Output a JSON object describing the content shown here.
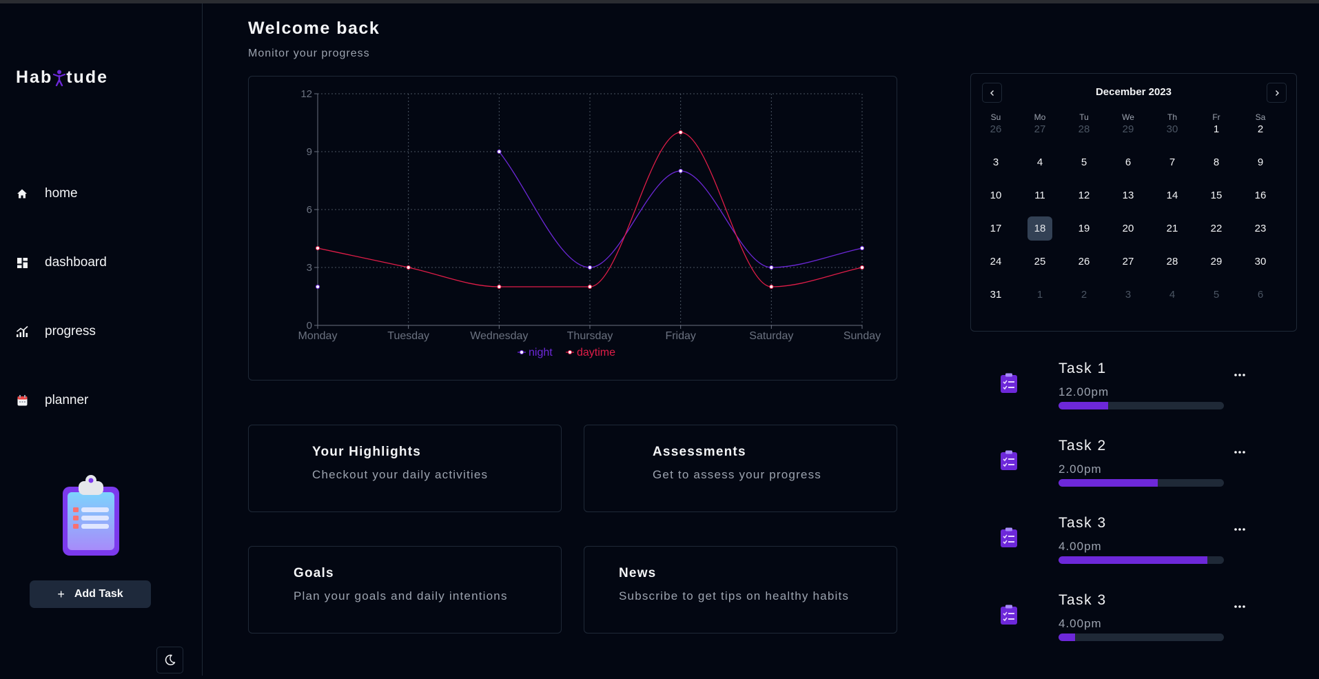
{
  "app": {
    "logo_left": "Hab",
    "logo_right": "tude"
  },
  "sidebar": {
    "items": [
      {
        "label": "home",
        "icon": "home-icon"
      },
      {
        "label": "dashboard",
        "icon": "dashboard-icon"
      },
      {
        "label": "progress",
        "icon": "progress-icon"
      },
      {
        "label": "planner",
        "icon": "planner-icon"
      }
    ],
    "add_task_label": "Add Task",
    "add_task_icon": "plus-icon",
    "theme_toggle_icon": "moon-icon",
    "illustration": "clipboard-illustration"
  },
  "header": {
    "title": "Welcome back",
    "subtitle": "Monitor your progress"
  },
  "chart_data": {
    "type": "line",
    "categories": [
      "Monday",
      "Tuesday",
      "Wednesday",
      "Thursday",
      "Friday",
      "Saturday",
      "Sunday"
    ],
    "ylim": [
      0,
      12
    ],
    "yticks": [
      "0",
      "3",
      "6",
      "9",
      "12"
    ],
    "grid": true,
    "legend_position": "bottom-center",
    "series": [
      {
        "name": "night",
        "color": "#6d28d9",
        "values": [
          2,
          null,
          9,
          3,
          8,
          3,
          4
        ]
      },
      {
        "name": "daytime",
        "color": "#e11d48",
        "values": [
          4,
          3,
          2,
          2,
          10,
          2,
          3
        ]
      }
    ]
  },
  "cards": [
    {
      "title": "Your Highlights",
      "desc": "Checkout your daily activities"
    },
    {
      "title": "Assessments",
      "desc": "Get to assess your progress"
    },
    {
      "title": "Goals",
      "desc": "Plan your goals and daily intentions"
    },
    {
      "title": "News",
      "desc": "Subscribe to get tips on healthy habits"
    }
  ],
  "calendar": {
    "title": "December 2023",
    "weekdays": [
      "Su",
      "Mo",
      "Tu",
      "We",
      "Th",
      "Fr",
      "Sa"
    ],
    "selected_day": "18",
    "weeks": [
      [
        {
          "d": "26",
          "m": true
        },
        {
          "d": "27",
          "m": true
        },
        {
          "d": "28",
          "m": true
        },
        {
          "d": "29",
          "m": true
        },
        {
          "d": "30",
          "m": true
        },
        {
          "d": "1"
        },
        {
          "d": "2"
        }
      ],
      [
        {
          "d": "3"
        },
        {
          "d": "4"
        },
        {
          "d": "5"
        },
        {
          "d": "6"
        },
        {
          "d": "7"
        },
        {
          "d": "8"
        },
        {
          "d": "9"
        }
      ],
      [
        {
          "d": "10"
        },
        {
          "d": "11"
        },
        {
          "d": "12"
        },
        {
          "d": "13"
        },
        {
          "d": "14"
        },
        {
          "d": "15"
        },
        {
          "d": "16"
        }
      ],
      [
        {
          "d": "17"
        },
        {
          "d": "18"
        },
        {
          "d": "19"
        },
        {
          "d": "20"
        },
        {
          "d": "21"
        },
        {
          "d": "22"
        },
        {
          "d": "23"
        }
      ],
      [
        {
          "d": "24"
        },
        {
          "d": "25"
        },
        {
          "d": "26"
        },
        {
          "d": "27"
        },
        {
          "d": "28"
        },
        {
          "d": "29"
        },
        {
          "d": "30"
        }
      ],
      [
        {
          "d": "31"
        },
        {
          "d": "1",
          "m": true
        },
        {
          "d": "2",
          "m": true
        },
        {
          "d": "3",
          "m": true
        },
        {
          "d": "4",
          "m": true
        },
        {
          "d": "5",
          "m": true
        },
        {
          "d": "6",
          "m": true
        }
      ]
    ]
  },
  "tasks": [
    {
      "name": "Task 1",
      "time": "12.00pm",
      "progress": 0.3
    },
    {
      "name": "Task 2",
      "time": "2.00pm",
      "progress": 0.6
    },
    {
      "name": "Task 3",
      "time": "4.00pm",
      "progress": 0.9
    },
    {
      "name": "Task 3",
      "time": "4.00pm",
      "progress": 0.1
    }
  ],
  "colors": {
    "accent": "#6d28d9",
    "daytime": "#e11d48",
    "background": "#030712",
    "border": "#1f2937"
  }
}
